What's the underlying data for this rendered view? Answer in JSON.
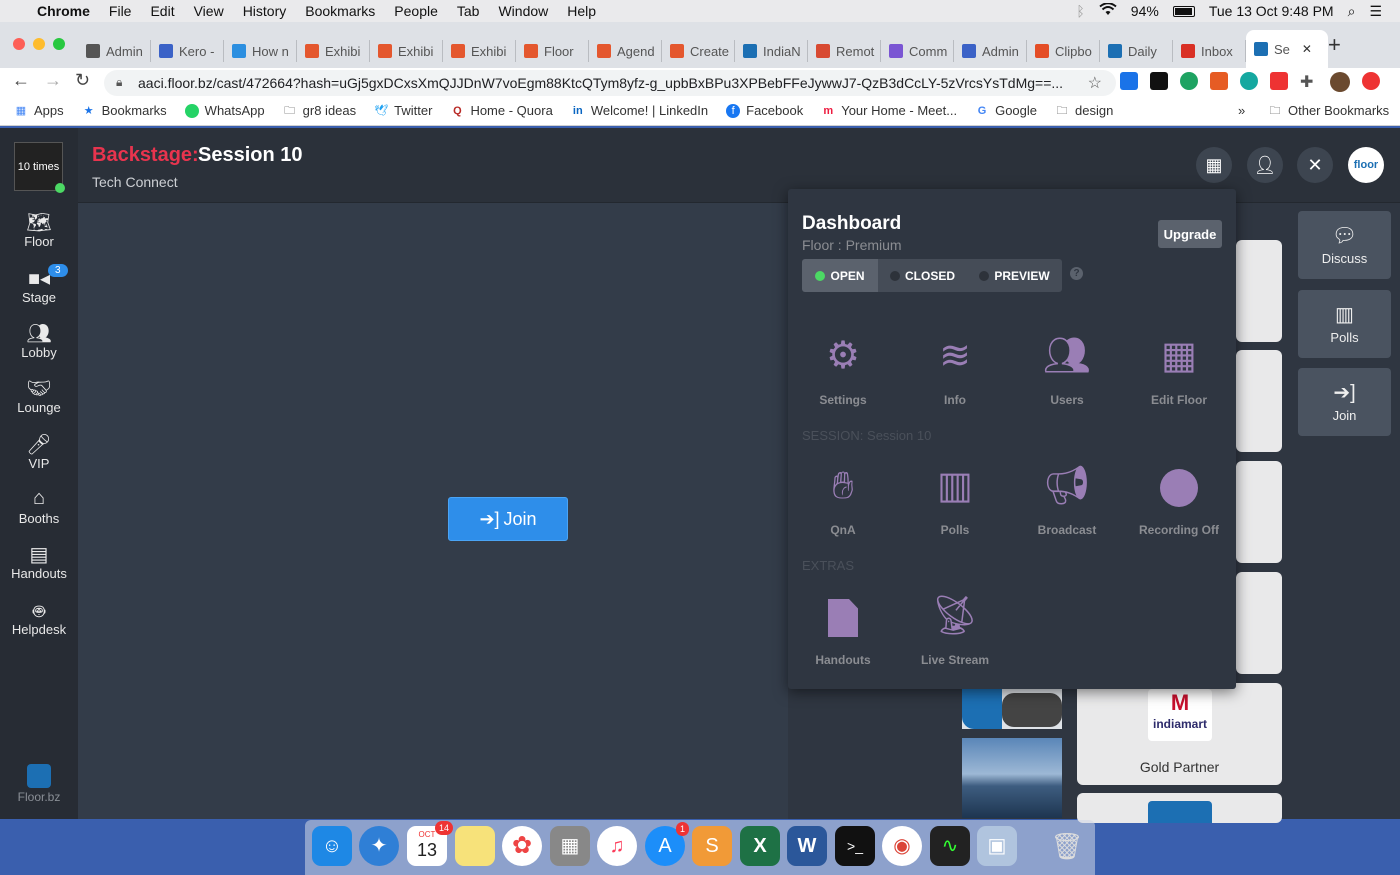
{
  "menubar": {
    "apple": "",
    "items": [
      "Chrome",
      "File",
      "Edit",
      "View",
      "History",
      "Bookmarks",
      "People",
      "Tab",
      "Window",
      "Help"
    ],
    "battery": "94%",
    "datetime": "Tue 13 Oct  9:48 PM"
  },
  "tabs": [
    {
      "label": "Admin",
      "color": "#555"
    },
    {
      "label": "Kero -",
      "color": "#3b62c7"
    },
    {
      "label": "How n",
      "color": "#2c8fe0"
    },
    {
      "label": "Exhibi",
      "color": "#e4572e"
    },
    {
      "label": "Exhibi",
      "color": "#e4572e"
    },
    {
      "label": "Exhibi",
      "color": "#e4572e"
    },
    {
      "label": "Floor",
      "color": "#e4572e"
    },
    {
      "label": "Agend",
      "color": "#e4572e"
    },
    {
      "label": "Create",
      "color": "#e4572e"
    },
    {
      "label": "IndiaN",
      "color": "#1c6fb3"
    },
    {
      "label": "Remot",
      "color": "#d84a32"
    },
    {
      "label": "Comm",
      "color": "#7a55d3"
    },
    {
      "label": "Admin",
      "color": "#3b62c7"
    },
    {
      "label": "Clipbo",
      "color": "#e44d26"
    },
    {
      "label": "Daily",
      "color": "#1c6fb3"
    },
    {
      "label": "Inbox",
      "color": "#d93025"
    },
    {
      "label": "Se",
      "color": "#1c6fb3"
    }
  ],
  "address": {
    "url": "aaci.floor.bz/cast/472664?hash=uGj5gxDCxsXmQJJDnW7voEgm88KtcQTym8yfz-g_upbBxBPu3XPBebFFeJywwJ7-QzB3dCcLY-5zVrcsYsTdMg==..."
  },
  "bookmarks": [
    "Apps",
    "Bookmarks",
    "WhatsApp",
    "gr8 ideas",
    "Twitter",
    "Home - Quora",
    "Welcome! | LinkedIn",
    "Facebook",
    "Your Home - Meet...",
    "Google",
    "design"
  ],
  "bookmarks_more": "»",
  "other_bookmarks": "Other Bookmarks",
  "app": {
    "logo_text": "10 times",
    "backstage_label": "Backstage:",
    "session_title": "Session 10",
    "subtitle": "Tech Connect",
    "nav": [
      {
        "label": "Floor",
        "icon": "map-icon"
      },
      {
        "label": "Stage",
        "icon": "video-icon",
        "badge": "3"
      },
      {
        "label": "Lobby",
        "icon": "users-icon"
      },
      {
        "label": "Lounge",
        "icon": "handshake-icon"
      },
      {
        "label": "VIP",
        "icon": "mic-icon"
      },
      {
        "label": "Booths",
        "icon": "store-icon"
      },
      {
        "label": "Handouts",
        "icon": "file-icon"
      },
      {
        "label": "Helpdesk",
        "icon": "robot-icon"
      }
    ],
    "footer_brand": "Floor.bz",
    "join_label": "Join",
    "top_right_avatar": "floor"
  },
  "dashboard": {
    "title": "Dashboard",
    "plan": "Floor : Premium",
    "upgrade": "Upgrade",
    "status": [
      {
        "label": "OPEN",
        "active": true,
        "dot": "#4cd964"
      },
      {
        "label": "CLOSED",
        "active": false,
        "dot": "#5b6069"
      },
      {
        "label": "PREVIEW",
        "active": false,
        "dot": "#5b6069"
      }
    ],
    "help": "?",
    "main_items": [
      "Settings",
      "Info",
      "Users",
      "Edit Floor"
    ],
    "session_heading": "SESSION: Session 10",
    "session_items": [
      "QnA",
      "Polls",
      "Broadcast",
      "Recording Off"
    ],
    "extras_heading": "EXTRAS",
    "extras_items": [
      "Handouts",
      "Live Stream"
    ]
  },
  "right_panel": [
    {
      "label": "Discuss",
      "icon": "chat-icon"
    },
    {
      "label": "Polls",
      "icon": "poll-icon"
    },
    {
      "label": "Join",
      "icon": "join-icon"
    }
  ],
  "sponsor": {
    "brand": "indiamart",
    "tier": "Gold Partner"
  },
  "dock": {
    "calendar_month": "OCT",
    "calendar_day": "13",
    "calendar_badge": "14",
    "appstore_badge": "1"
  },
  "colors": {
    "accent": "#e8344e",
    "button": "#2e8eea",
    "icon_purple": "#9a7eb5"
  }
}
